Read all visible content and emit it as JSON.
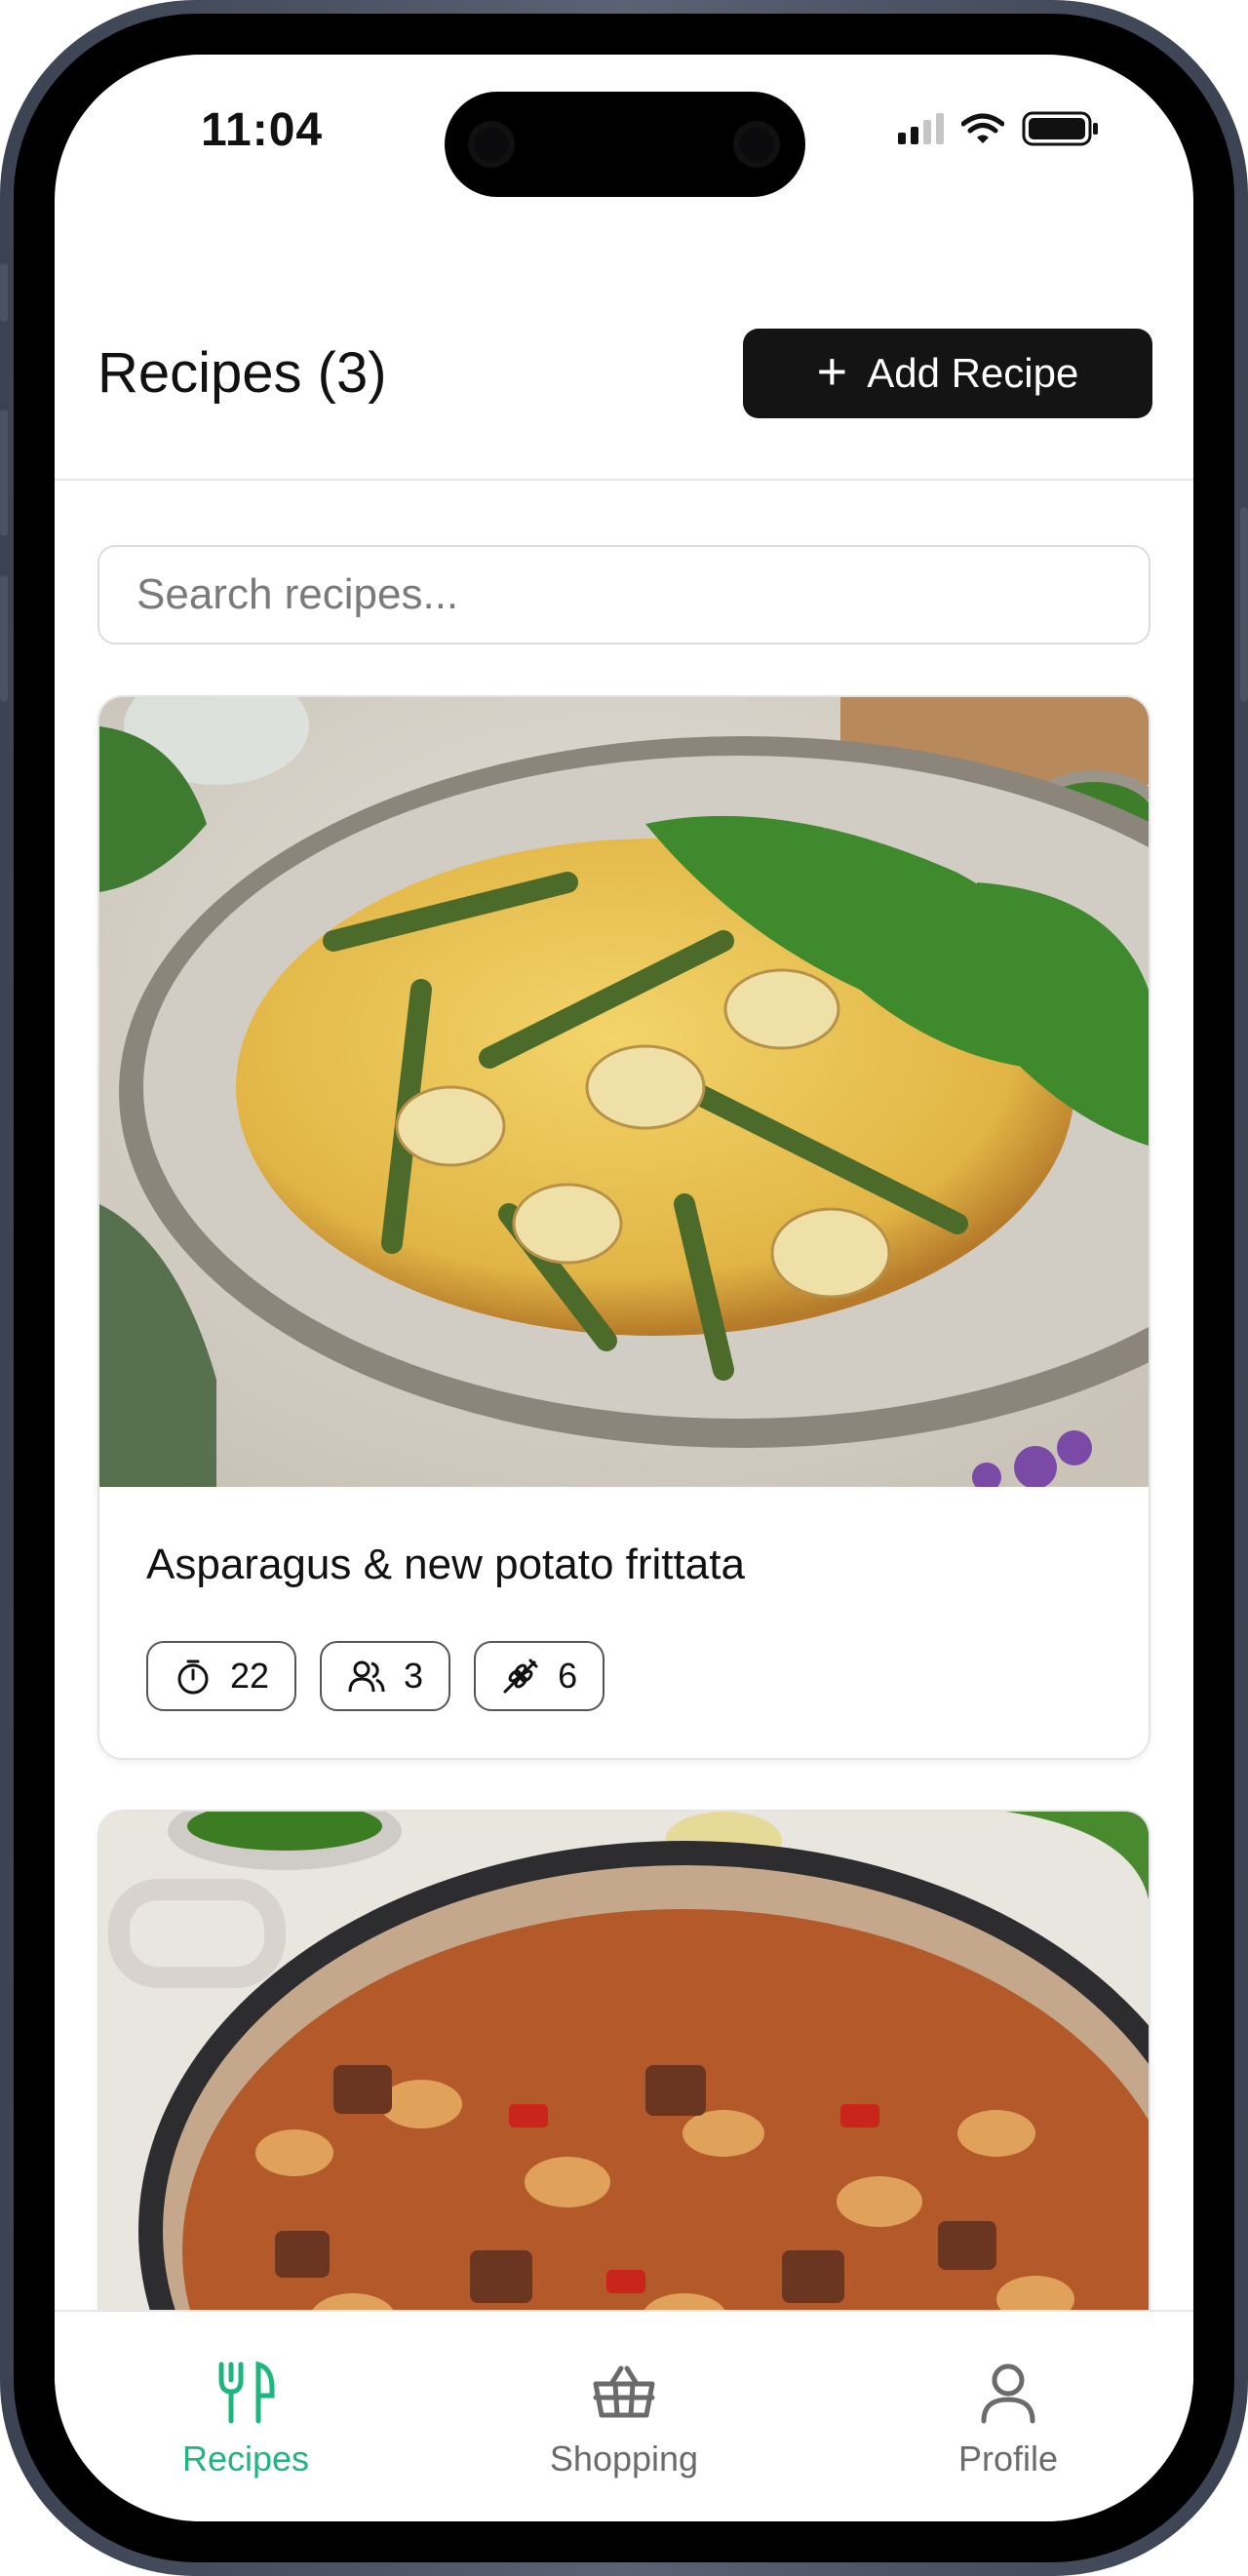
{
  "status_bar": {
    "time": "11:04"
  },
  "header": {
    "title": "Recipes (3)",
    "add_button_label": "Add Recipe",
    "add_button_icon": "plus-icon"
  },
  "search": {
    "placeholder": "Search recipes...",
    "value": ""
  },
  "recipes": [
    {
      "title": "Asparagus & new potato frittata",
      "image": "asparagus-frittata-photo",
      "time": "22",
      "servings": "3",
      "ingredients": "6"
    },
    {
      "title": "",
      "image": "beef-pasta-stew-photo"
    }
  ],
  "bottom_nav": {
    "items": [
      {
        "label": "Recipes",
        "icon": "fork-knife-icon",
        "active": true
      },
      {
        "label": "Shopping",
        "icon": "basket-icon",
        "active": false
      },
      {
        "label": "Profile",
        "icon": "person-icon",
        "active": false
      }
    ]
  },
  "colors": {
    "accent": "#1fb67e",
    "text": "#111111",
    "muted": "#6b6b6b",
    "button_bg": "#141414"
  }
}
